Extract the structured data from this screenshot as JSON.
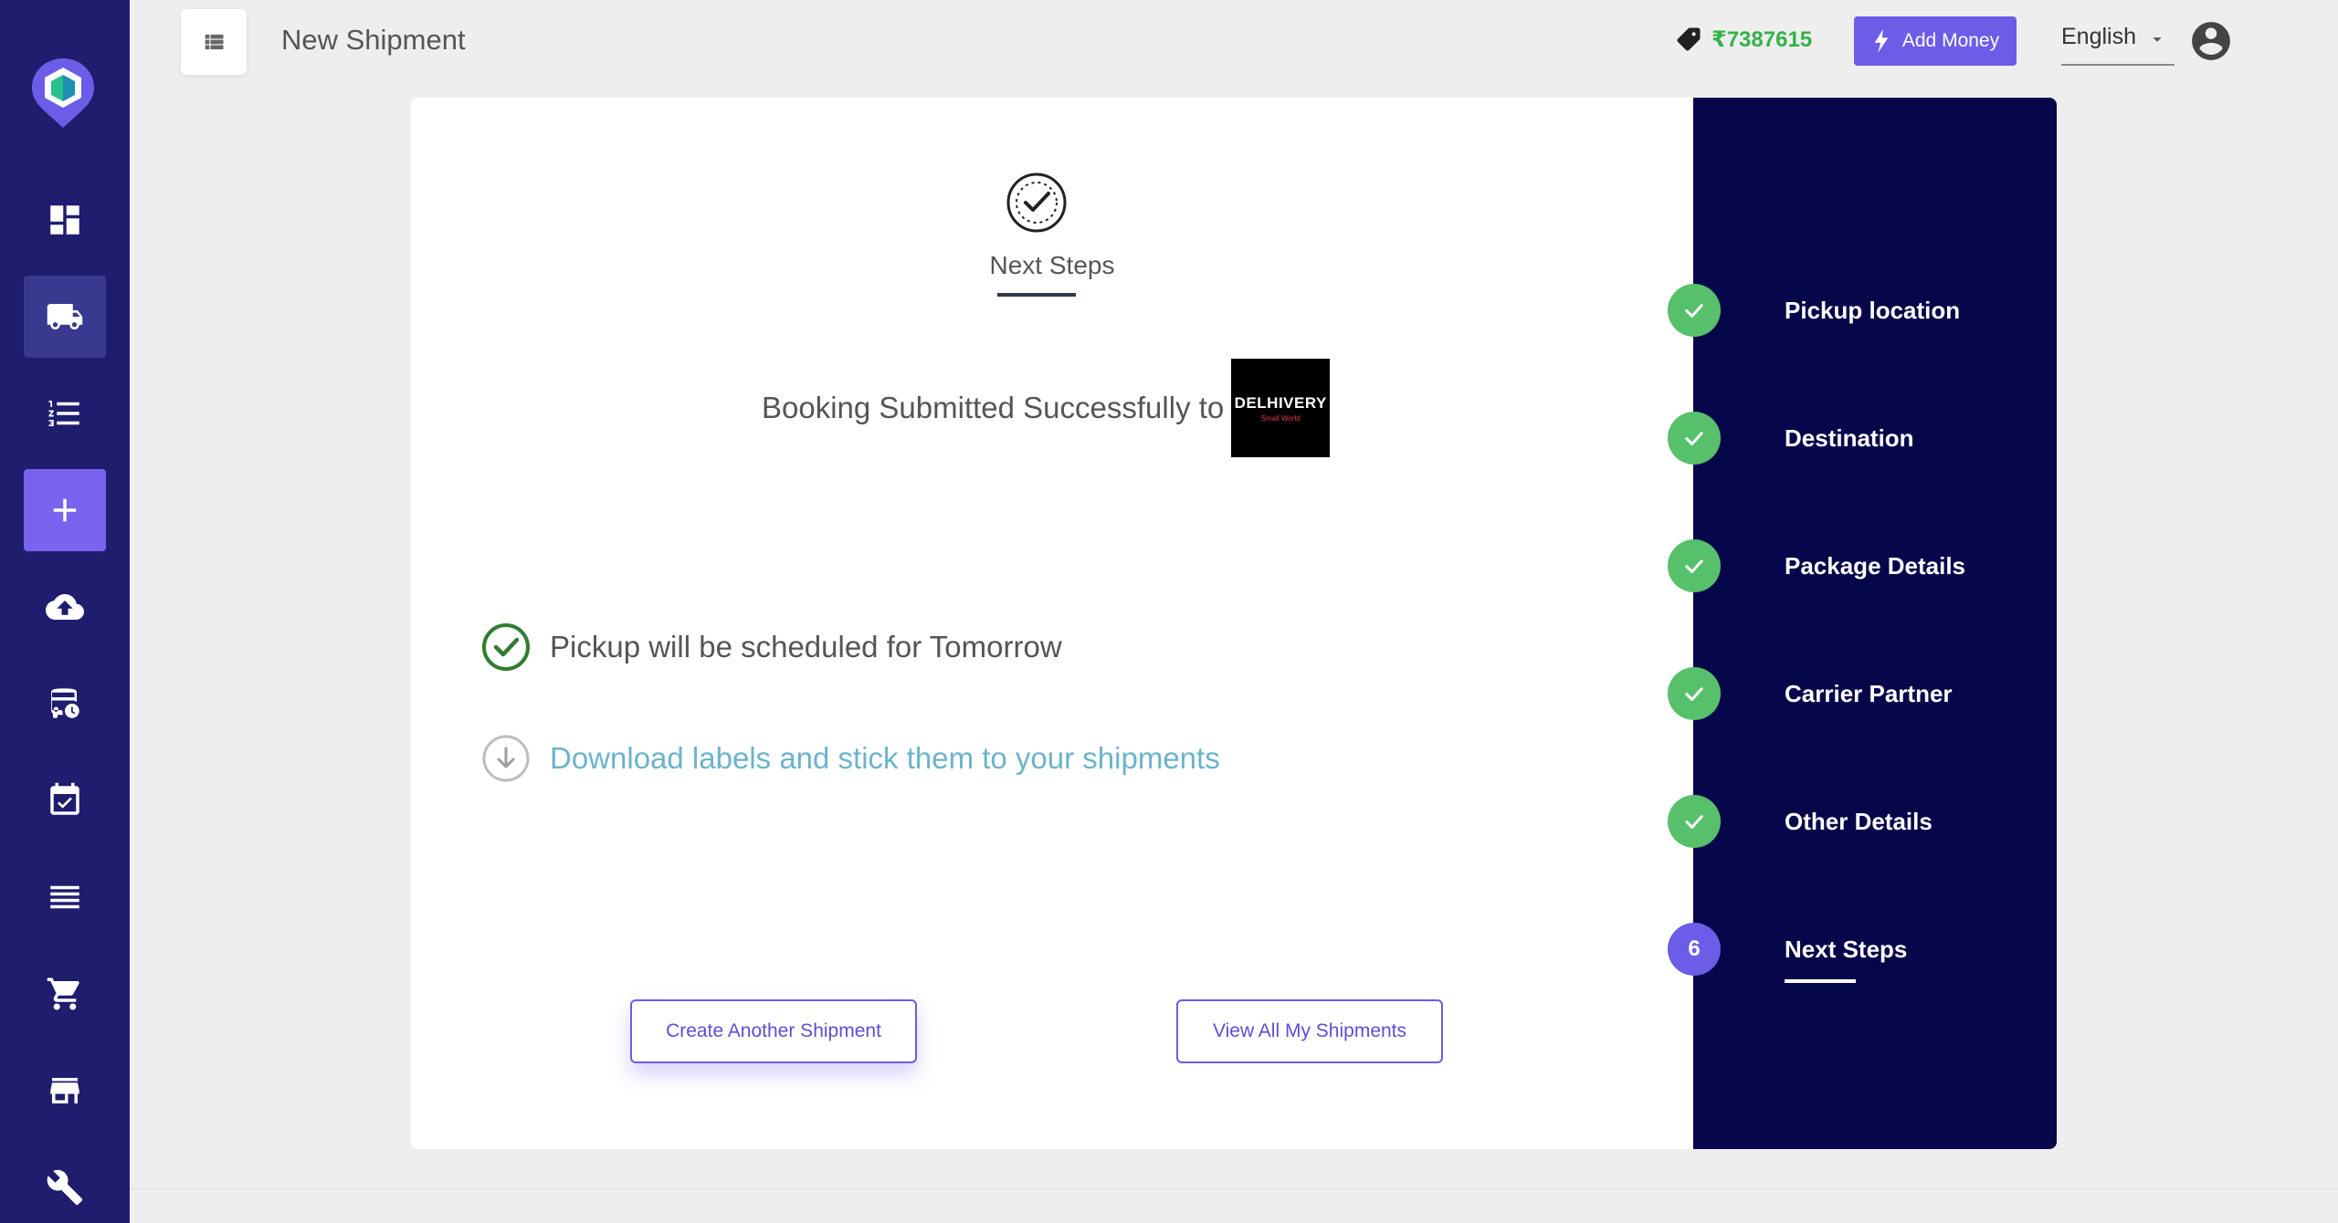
{
  "header": {
    "title": "New Shipment",
    "wallet_amount": "₹7387615",
    "add_money_label": "Add Money",
    "language": "English"
  },
  "sidebar": {
    "items": [
      {
        "icon": "dashboard-icon"
      },
      {
        "icon": "truck-icon",
        "active": true
      },
      {
        "icon": "list-icon"
      },
      {
        "icon": "plus-icon"
      },
      {
        "icon": "cloud-upload-icon"
      },
      {
        "icon": "bus-clock-icon"
      },
      {
        "icon": "calendar-check-icon"
      },
      {
        "icon": "rows-icon"
      },
      {
        "icon": "cart-icon"
      },
      {
        "icon": "store-icon"
      },
      {
        "icon": "wrench-icon"
      }
    ]
  },
  "main": {
    "heading": "Next Steps",
    "booking_text": "Booking Submitted Successfully to",
    "carrier_logo_text": "DELHIVERY",
    "carrier_logo_tagline": "Small World",
    "info_lines": [
      {
        "text": "Pickup will be scheduled for Tomorrow",
        "icon": "check-circle-icon"
      },
      {
        "text": "Download labels and stick them to your shipments",
        "icon": "download-circle-icon"
      }
    ],
    "buttons": {
      "create": "Create Another Shipment",
      "view_all": "View All My Shipments"
    }
  },
  "stepper": {
    "steps": [
      {
        "label": "Pickup location",
        "status": "done"
      },
      {
        "label": "Destination",
        "status": "done"
      },
      {
        "label": "Package Details",
        "status": "done"
      },
      {
        "label": "Carrier Partner",
        "status": "done"
      },
      {
        "label": "Other Details",
        "status": "done"
      },
      {
        "label": "Next Steps",
        "status": "current",
        "number": "6"
      }
    ]
  },
  "colors": {
    "sidebar": "#1e1d6e",
    "accent": "#6c5ce7",
    "stepper_bg": "#06074a",
    "done_green": "#56c06a",
    "wallet_green": "#35b24a",
    "link_blue": "#6cb3cc"
  }
}
